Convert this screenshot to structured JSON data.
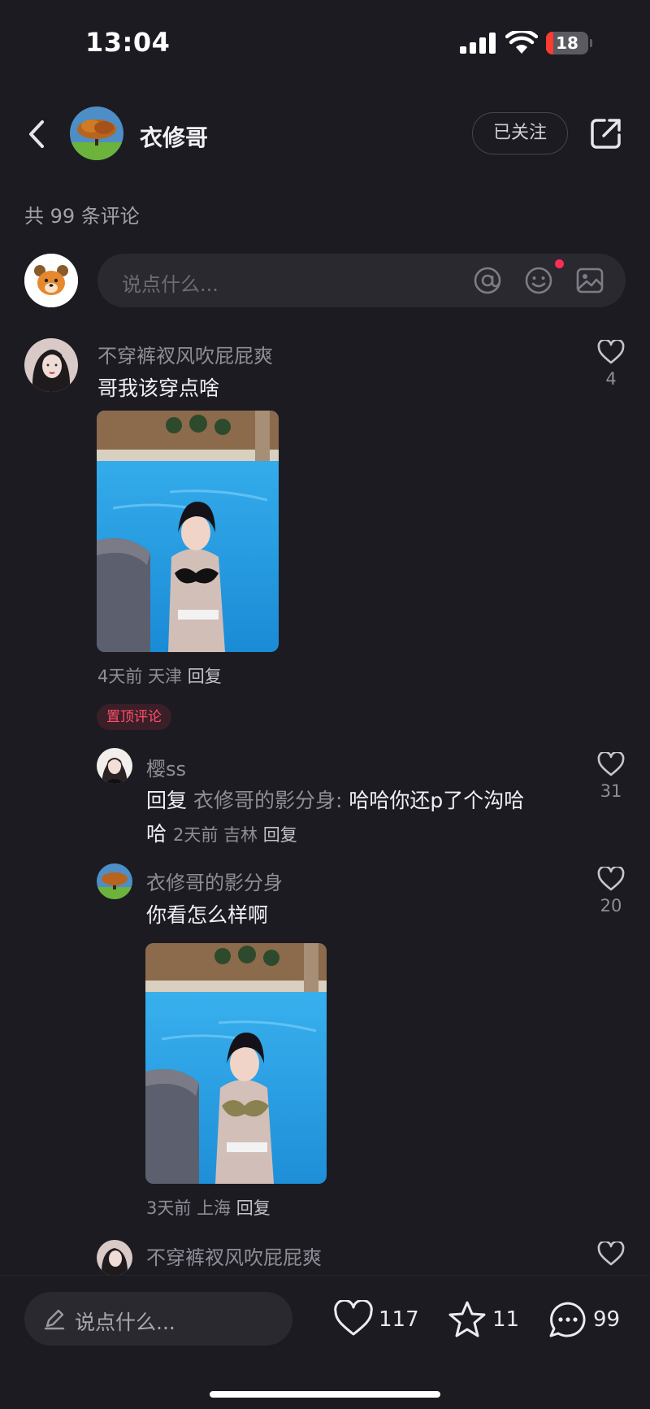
{
  "status_bar": {
    "time": "13:04",
    "battery": "18"
  },
  "header": {
    "title": "衣修哥",
    "follow_label": "已关注"
  },
  "comment_count": "共 99 条评论",
  "composer": {
    "placeholder": "说点什么..."
  },
  "comments": [
    {
      "name": "不穿裤衩风吹屁屁爽",
      "text": "哥我该穿点啥",
      "time": "4天前",
      "location": "天津",
      "reply": "回复",
      "likes": "4"
    }
  ],
  "pinned_label": "置顶评论",
  "replies": [
    {
      "name": "樱ss",
      "reply_prefix": "回复",
      "reply_to": "衣修哥的影分身:",
      "text_line1": "哈哈你还p了个沟哈",
      "text_line2": "哈",
      "time": "2天前",
      "location": "吉林",
      "reply": "回复",
      "likes": "31"
    },
    {
      "name": "衣修哥的影分身",
      "text": "你看怎么样啊",
      "time": "3天前",
      "location": "上海",
      "reply": "回复",
      "likes": "20"
    },
    {
      "name": "不穿裤衩风吹屁屁爽"
    }
  ],
  "bottom_bar": {
    "placeholder": "说点什么...",
    "likes": "117",
    "favorites": "11",
    "comments": "99"
  },
  "colors": {
    "background": "#1c1b22",
    "accent_red": "#ff2d55",
    "pool_blue": "#2fa7e8"
  },
  "icons": [
    "back-icon",
    "share-icon",
    "at-icon",
    "emoji-icon",
    "image-icon",
    "heart-icon",
    "star-icon",
    "comment-icon",
    "pencil-icon"
  ]
}
